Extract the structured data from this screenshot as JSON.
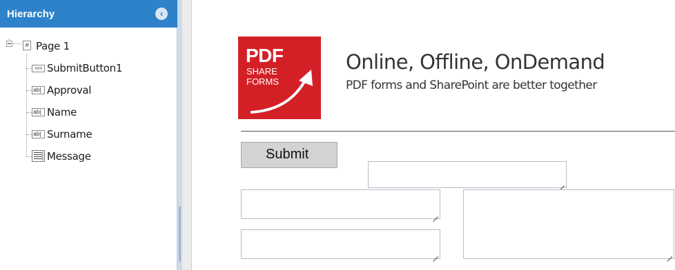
{
  "panel": {
    "title": "Hierarchy",
    "collapse_icon": "chevron-left-circle-icon",
    "page": {
      "label": "Page 1",
      "icon": "page-icon"
    },
    "items": [
      {
        "label": "SubmitButton1",
        "icon": "button-field-icon"
      },
      {
        "label": "Approval",
        "icon": "text-field-icon"
      },
      {
        "label": "Name",
        "icon": "text-field-icon"
      },
      {
        "label": "Surname",
        "icon": "text-field-icon"
      },
      {
        "label": "Message",
        "icon": "multiline-field-icon"
      }
    ]
  },
  "form": {
    "logo": {
      "line1": "PDF",
      "line2": "SHARE",
      "line3": "FORMS"
    },
    "headline": "Online, Offline, OnDemand",
    "tagline": "PDF forms and SharePoint are better together",
    "submit_label": "Submit"
  },
  "colors": {
    "header_blue": "#2d82c9",
    "logo_red": "#d32027"
  }
}
